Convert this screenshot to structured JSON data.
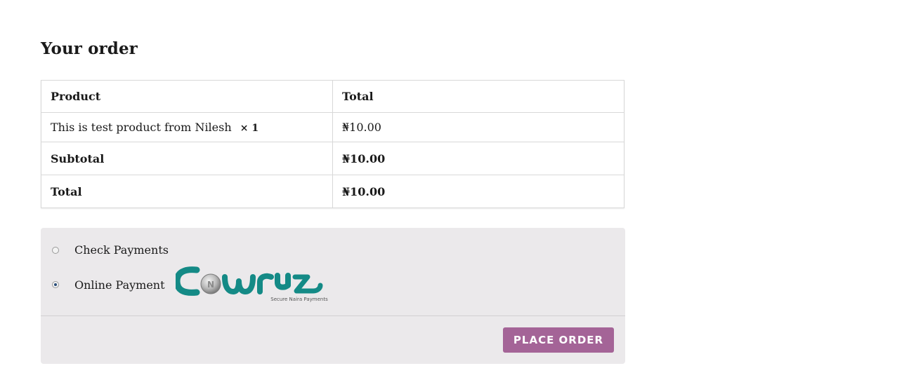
{
  "heading": "Your order",
  "table": {
    "headers": {
      "product": "Product",
      "total": "Total"
    },
    "items": [
      {
        "name": "This is test product from Nilesh",
        "qty": "× 1",
        "total": "₦10.00"
      }
    ],
    "subtotal": {
      "label": "Subtotal",
      "value": "₦10.00"
    },
    "total": {
      "label": "Total",
      "value": "₦10.00"
    }
  },
  "payment": {
    "methods": [
      {
        "label": "Check Payments",
        "selected": false
      },
      {
        "label": "Online Payment",
        "selected": true,
        "logo_text": "Cowryz",
        "logo_tagline": "Secure Naira Payments",
        "logo_coin_letter": "N"
      }
    ],
    "colors": {
      "logo_teal": "#148a86",
      "button": "#a46497",
      "panel": "#ebe9eb"
    }
  },
  "button": {
    "place_order": "PLACE ORDER"
  }
}
